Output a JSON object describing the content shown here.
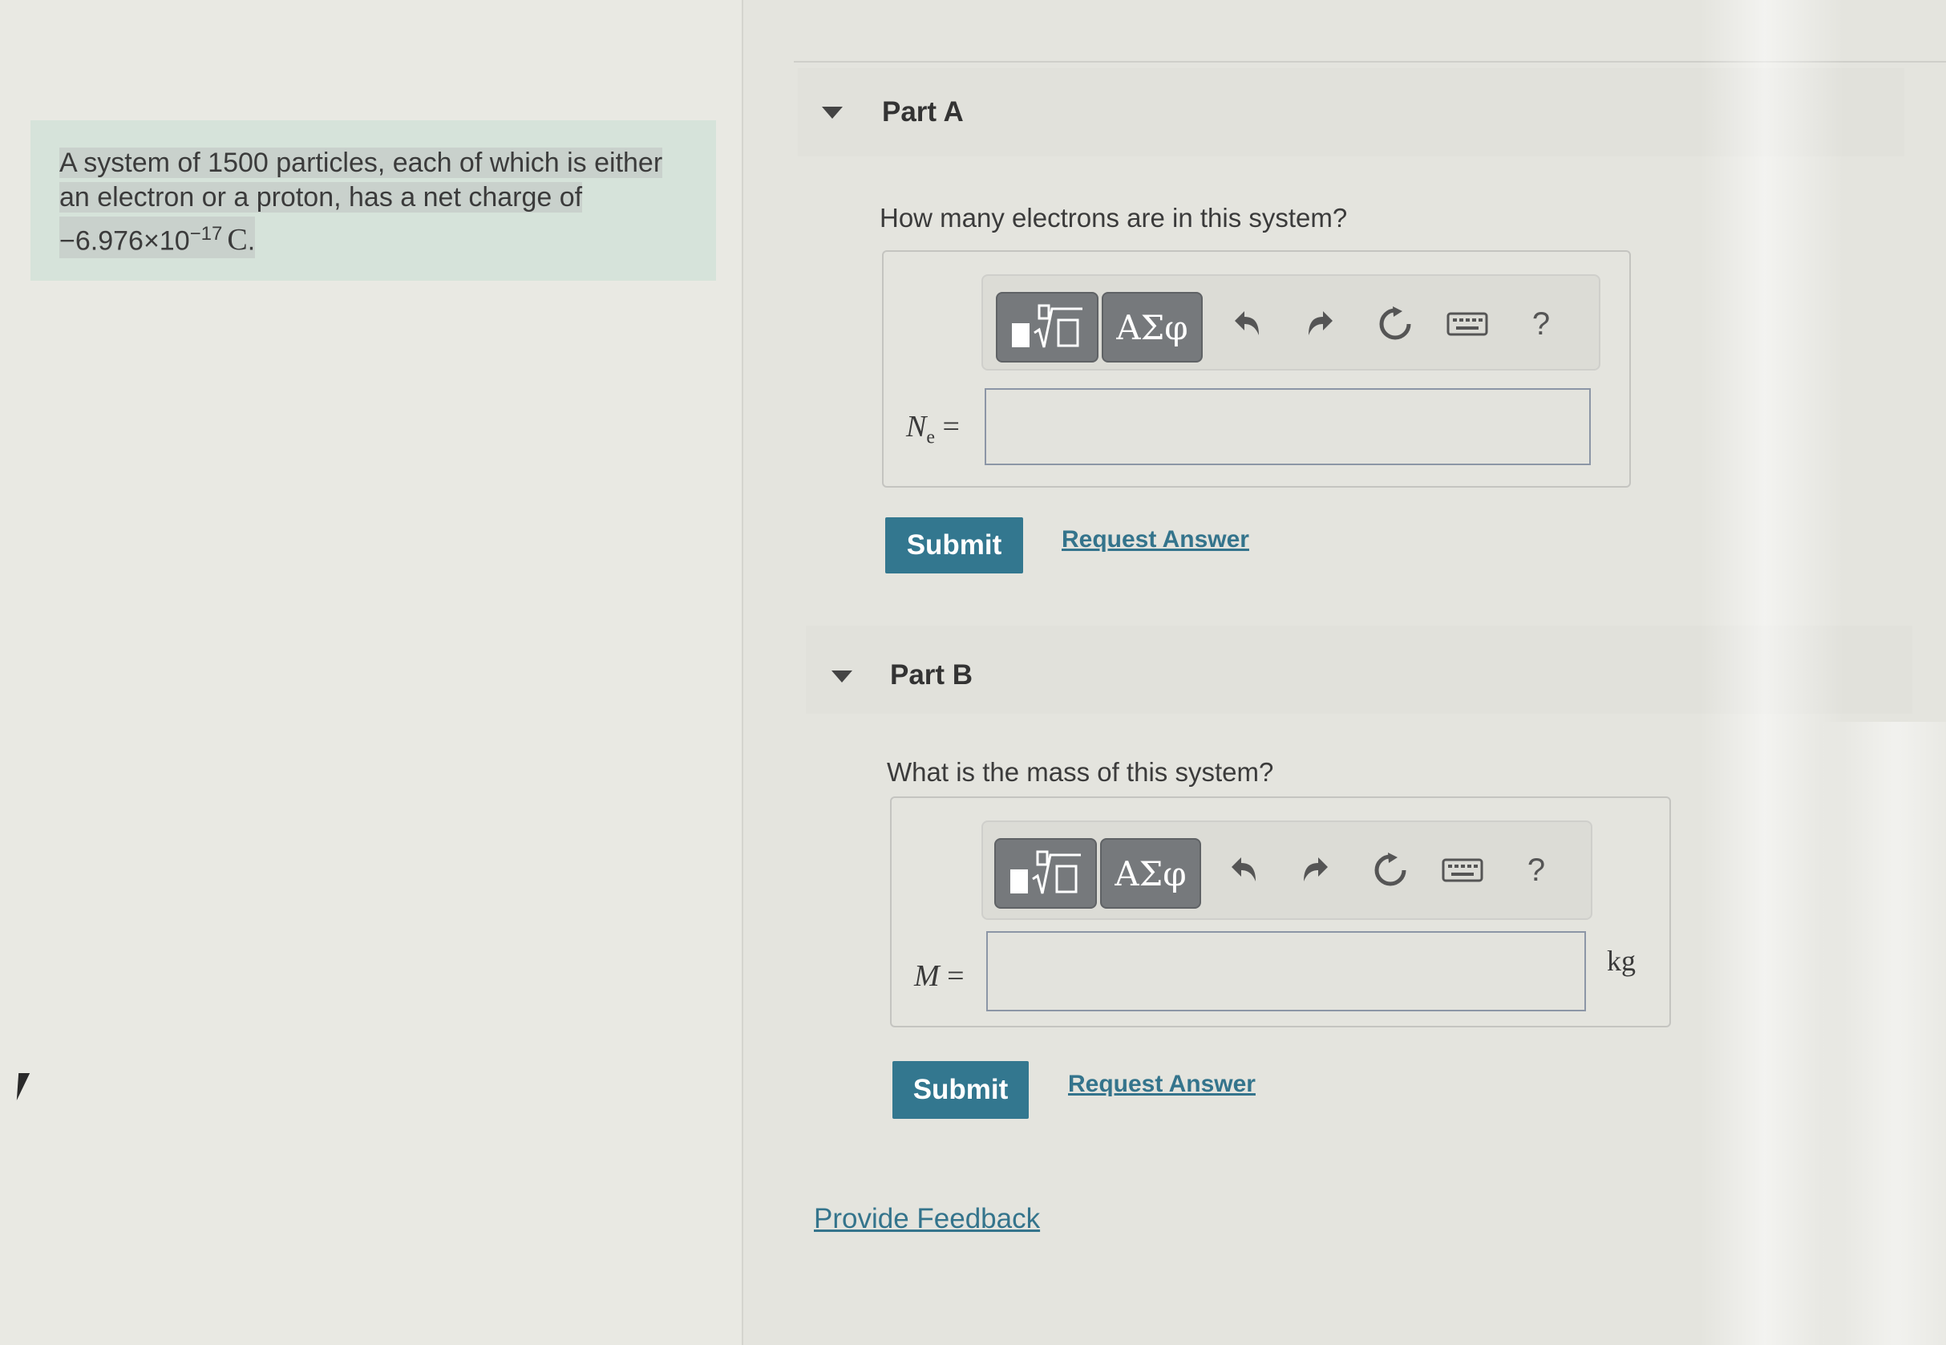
{
  "problem": {
    "line1": "A system of 1500 particles, each of which is either",
    "line2": "an electron or a proton, has a net charge of",
    "charge_mantissa": "−6.976×10",
    "charge_exponent": "−17",
    "charge_unit": "C",
    "charge_end": "."
  },
  "parts": [
    {
      "title": "Part A",
      "question": "How many electrons are in this system?",
      "label_symbol": "N",
      "label_subscript": "e",
      "label_equals": "=",
      "input_value": "",
      "unit": "",
      "submit_label": "Submit",
      "request_label": "Request Answer"
    },
    {
      "title": "Part B",
      "question": "What is the mass of this system?",
      "label_symbol": "M",
      "label_subscript": "",
      "label_equals": "=",
      "input_value": "",
      "unit": "kg",
      "submit_label": "Submit",
      "request_label": "Request Answer"
    }
  ],
  "toolbar": {
    "templates_icon": "fraction-sqrt-icon",
    "greek_label": "ΑΣφ",
    "undo_icon": "undo-icon",
    "redo_icon": "redo-icon",
    "reset_icon": "reset-icon",
    "keyboard_icon": "keyboard-icon",
    "help_label": "?"
  },
  "feedback_label": "Provide Feedback",
  "colors": {
    "submit": "#33778f",
    "link": "#34748c",
    "problem_bg": "#d6e3da"
  }
}
